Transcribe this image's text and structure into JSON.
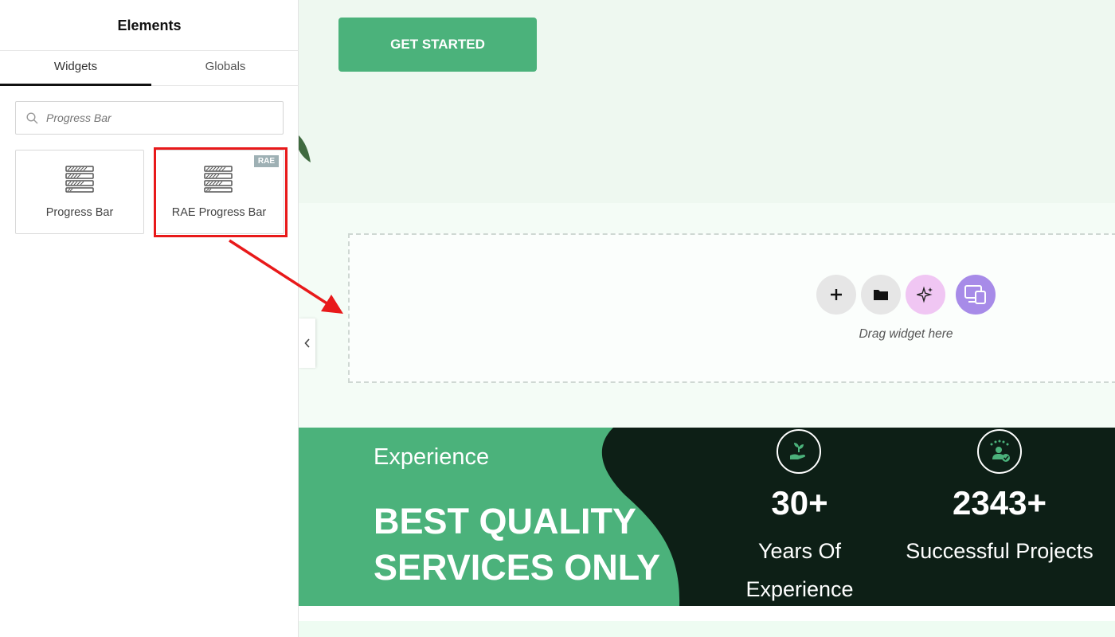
{
  "panel": {
    "title": "Elements",
    "tabs": [
      {
        "label": "Widgets",
        "active": true
      },
      {
        "label": "Globals",
        "active": false
      }
    ],
    "search": {
      "value": "",
      "placeholder": "Progress Bar"
    },
    "widgets": [
      {
        "label": "Progress Bar",
        "icon": "progress-bar-icon"
      },
      {
        "label": "RAE Progress Bar",
        "icon": "progress-bar-icon",
        "badge": "RAE"
      }
    ],
    "collapse_icon": "chevron-left-icon"
  },
  "canvas": {
    "cta_label": "GET STARTED",
    "dropzone": {
      "label": "Drag widget here",
      "buttons": [
        "plus-icon",
        "folder-icon",
        "sparkle-icon",
        "responsive-icon"
      ]
    },
    "stats": {
      "kicker": "Experience",
      "headline": "BEST QUALITY SERVICES ONLY",
      "items": [
        {
          "number": "30+",
          "label": "Years Of Experience",
          "icon": "plant-hand-icon"
        },
        {
          "number": "2343+",
          "label": "Successful Projects",
          "icon": "star-user-icon"
        }
      ]
    }
  },
  "colors": {
    "brand_green": "#4bb27b",
    "dark_green": "#0d1f16",
    "highlight_red": "#e8191a",
    "ai_pink": "#f0c6f3",
    "responsive_purple": "#a78be8"
  }
}
